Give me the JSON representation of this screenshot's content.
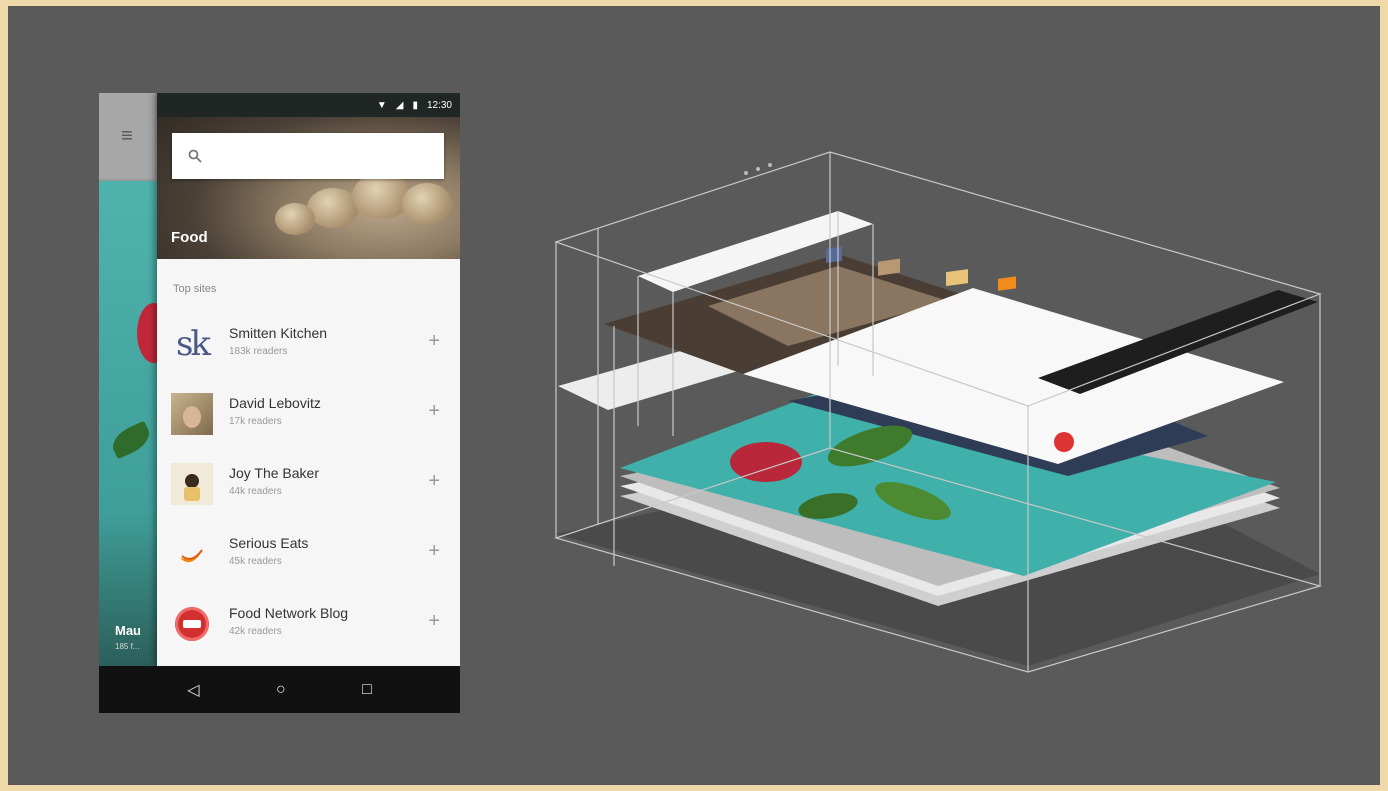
{
  "status_bar": {
    "time": "12:30"
  },
  "search": {
    "value": "",
    "placeholder": ""
  },
  "hero": {
    "title": "Food"
  },
  "section": {
    "label": "Top sites"
  },
  "sites": [
    {
      "name": "Smitten Kitchen",
      "meta": "183k readers",
      "avatar": "sk-logo"
    },
    {
      "name": "David Lebovitz",
      "meta": "17k readers",
      "avatar": "photo-portrait"
    },
    {
      "name": "Joy The Baker",
      "meta": "44k readers",
      "avatar": "photo-person"
    },
    {
      "name": "Serious Eats",
      "meta": "45k readers",
      "avatar": "orange-logo"
    },
    {
      "name": "Food Network Blog",
      "meta": "42k readers",
      "avatar": "red-badge-logo"
    }
  ],
  "behind": {
    "caption": "Mau",
    "caption_sub": "185 f..."
  },
  "colors": {
    "backdrop": "#5a5a5a",
    "border": "#f0d9a8",
    "drawer_bg": "#f6f6f6",
    "teal": "#4fb3ac",
    "nav_bg": "#111111"
  }
}
